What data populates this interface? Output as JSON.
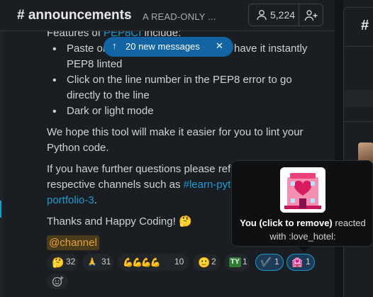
{
  "channel": {
    "name": "# announcements",
    "topic": "A READ-ONLY ...",
    "member_count": "5,224"
  },
  "banner": {
    "text": "20 new messages"
  },
  "message": {
    "intro_prefix": "Features of",
    "intro_link": "PEP8CI",
    "intro_suffix": "include:",
    "bullets": [
      {
        "line1_prefix": "Paste or",
        "line1_suffix": "have it instantly",
        "line2": "PEP8 linted"
      },
      {
        "line1": "Click on the line number in the PEP8 error to go",
        "line2": "directly to the line"
      },
      {
        "line1": "Dark or light mode"
      }
    ],
    "para1_line1": "We hope this tool will make it easier for you to lint your",
    "para1_line2": "Python code.",
    "para2_line1": "If you have further questions please refe",
    "para2_line2_prefix": "respective channels such as",
    "para2_link1": "#learn-pyth",
    "para2_link2": "portfolio-3",
    "para2_end": ".",
    "signoff": "Thanks and Happy Coding! 🤔",
    "mention": "@channel"
  },
  "reactions": [
    {
      "emoji": "🤔",
      "count": "32",
      "active": false
    },
    {
      "emoji": "🙏",
      "count": "31",
      "active": false
    },
    {
      "emoji": "💪💪💪💪",
      "count": "10",
      "active": false
    },
    {
      "emoji": "🙂",
      "count": "2",
      "active": false
    },
    {
      "emoji": "TY",
      "count": "1",
      "active": false
    },
    {
      "emoji": "✔️",
      "count": "1",
      "active": true
    },
    {
      "emoji": "🏩",
      "count": "1",
      "active": true
    }
  ],
  "tooltip": {
    "bold": "You (click to remove)",
    "rest": " reacted with :love_hotel:",
    "emoji_name": "love_hotel"
  },
  "right_pane": {
    "hash": "#"
  },
  "colors": {
    "accent": "#1d9bd1",
    "banner": "#1264a3",
    "mention_text": "#e8a23a"
  }
}
